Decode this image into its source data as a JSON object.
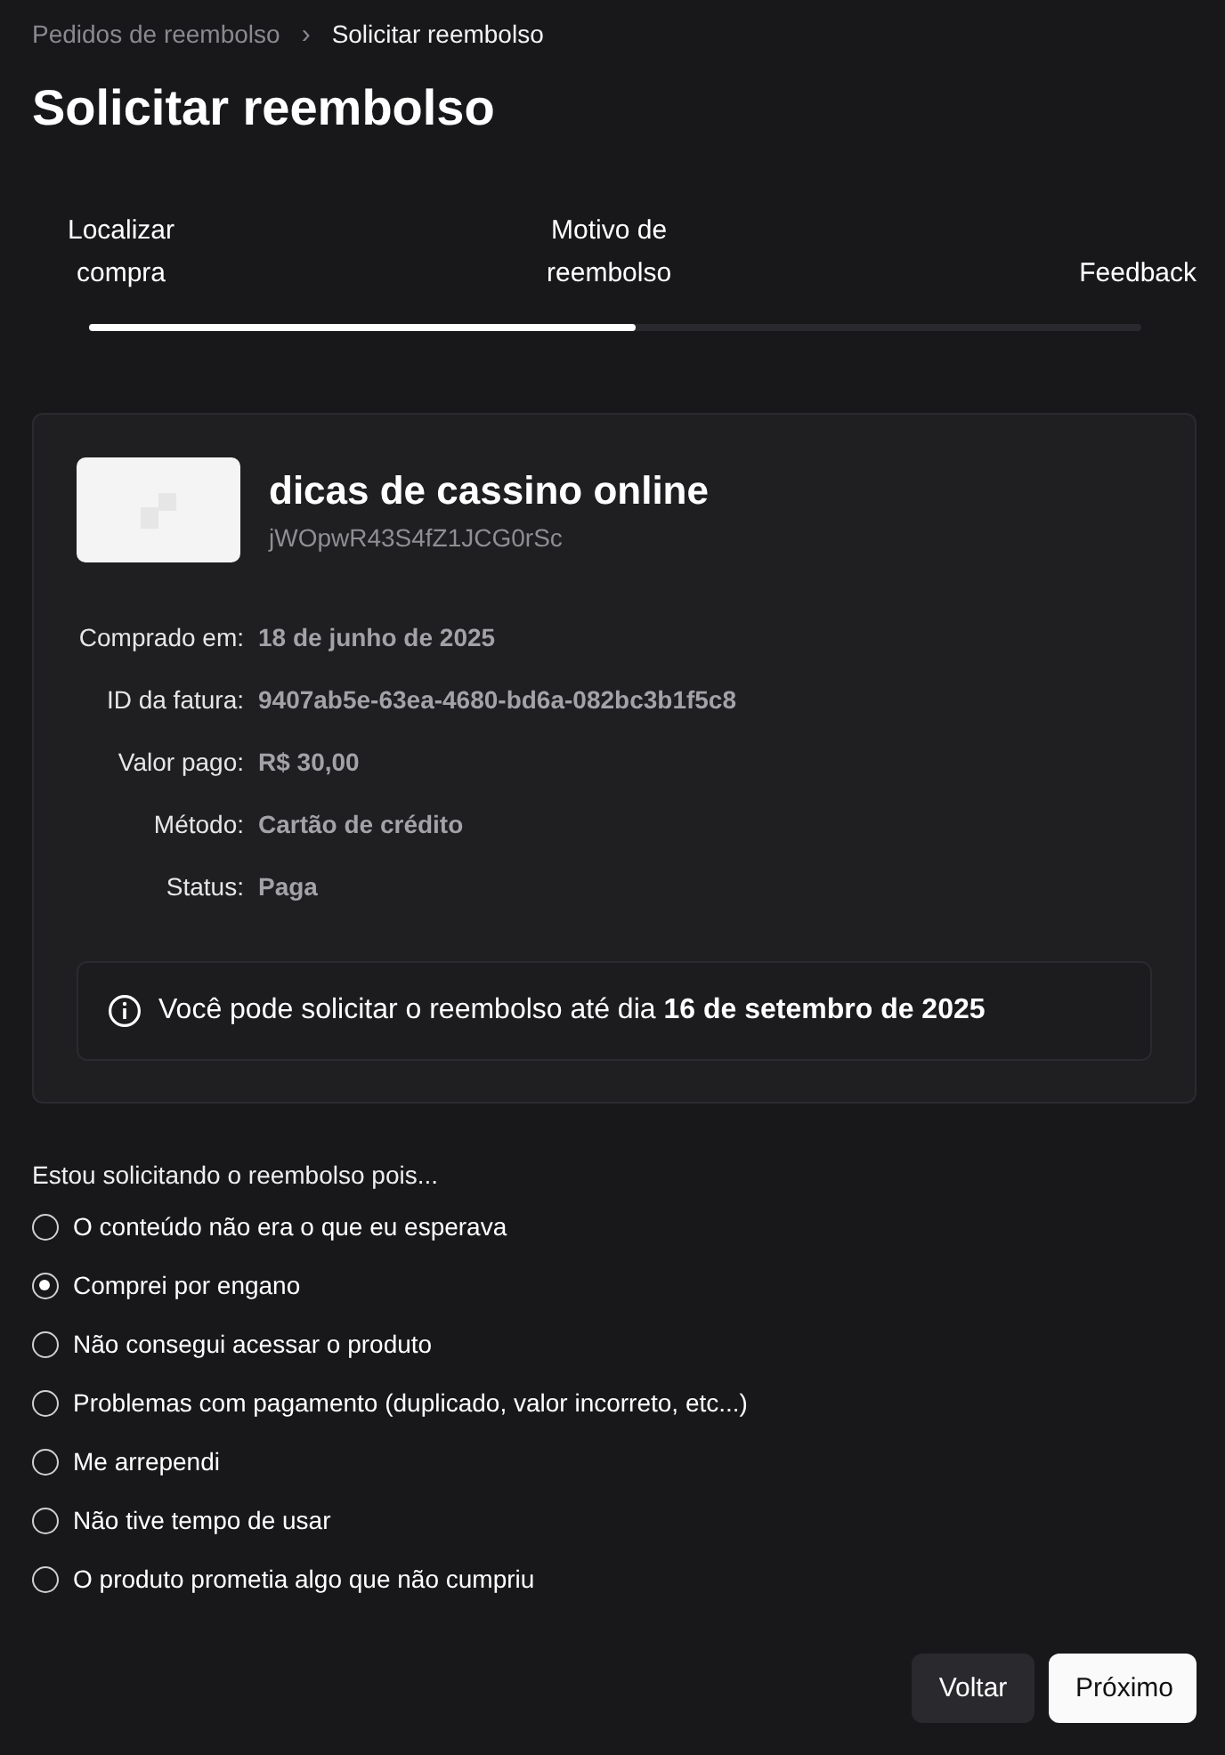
{
  "breadcrumb": [
    {
      "label": "Pedidos de reembolso",
      "current": false
    },
    {
      "label": "Solicitar reembolso",
      "current": true
    }
  ],
  "breadcrumb_separator": "›",
  "title": "Solicitar reembolso",
  "steps": [
    {
      "label": "Localizar compra"
    },
    {
      "label": "Motivo de reembolso"
    },
    {
      "label": "Feedback"
    }
  ],
  "progress": {
    "level": 0.52
  },
  "product": {
    "name": "dicas de cassino online",
    "code": "jWOpwR43S4fZ1JCG0rSc"
  },
  "details": [
    {
      "label": "Comprado em:",
      "value": "18 de junho de 2025"
    },
    {
      "label": "ID da fatura:",
      "value": "9407ab5e-63ea-4680-bd6a-082bc3b1f5c8"
    },
    {
      "label": "Valor pago:",
      "value": "R$ 30,00"
    },
    {
      "label": "Método:",
      "value": "Cartão de crédito"
    },
    {
      "label": "Status:",
      "value": "Paga"
    }
  ],
  "notice": "Você pode solicitar o reembolso até dia **16 de setembro de 2025**",
  "reason_prompt": "Estou solicitando o reembolso pois...",
  "reasons": [
    {
      "label": "O conteúdo não era o que eu esperava",
      "selected": false
    },
    {
      "label": "Comprei por engano",
      "selected": true
    },
    {
      "label": "Não consegui acessar o produto",
      "selected": false
    },
    {
      "label": "Problemas com pagamento (duplicado, valor incorreto, etc...)",
      "selected": false
    },
    {
      "label": "Me arrependi",
      "selected": false
    },
    {
      "label": "Não tive tempo de usar",
      "selected": false
    },
    {
      "label": "O produto prometia algo que não cumpriu",
      "selected": false
    }
  ],
  "buttons": [
    {
      "label": "Voltar",
      "kind": "secondary"
    },
    {
      "label": "Próximo",
      "kind": "primary"
    }
  ]
}
